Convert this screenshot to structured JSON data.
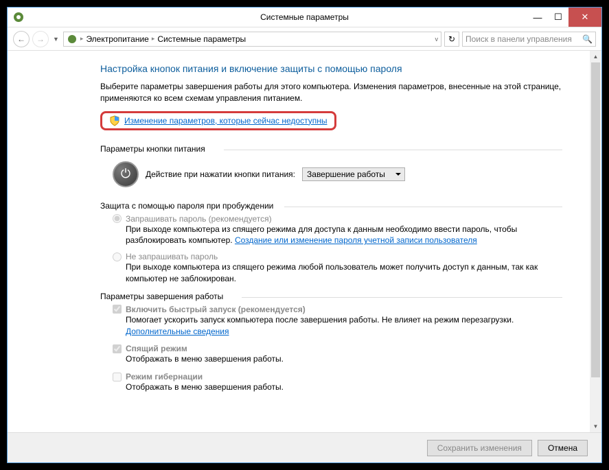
{
  "titlebar": {
    "title": "Системные параметры"
  },
  "breadcrumb": {
    "item1": "Электропитание",
    "item2": "Системные параметры"
  },
  "search": {
    "placeholder": "Поиск в панели управления"
  },
  "heading": "Настройка кнопок питания и включение защиты с помощью пароля",
  "intro": "Выберите параметры завершения работы для этого компьютера. Изменения параметров, внесенные на этой странице, применяются ко всем схемам управления питанием.",
  "change_link": "Изменение параметров, которые сейчас недоступны",
  "sections": {
    "buttons": {
      "title": "Параметры кнопки питания",
      "action_label": "Действие при нажатии кнопки питания:",
      "action_value": "Завершение работы"
    },
    "password": {
      "title": "Защита с помощью пароля при пробуждении",
      "opt1_label": "Запрашивать пароль (рекомендуется)",
      "opt1_desc_a": "При выходе компьютера из спящего режима для доступа к данным необходимо ввести пароль, чтобы разблокировать компьютер. ",
      "opt1_link": "Создание или изменение пароля учетной записи пользователя",
      "opt2_label": "Не запрашивать пароль",
      "opt2_desc": "При выходе компьютера из спящего режима любой пользователь может получить доступ к данным, так как компьютер не заблокирован."
    },
    "shutdown": {
      "title": "Параметры завершения работы",
      "fast_label": "Включить быстрый запуск (рекомендуется)",
      "fast_desc_a": "Помогает ускорить запуск компьютера после завершения работы. Не влияет на режим перезагрузки. ",
      "fast_link": "Дополнительные сведения",
      "sleep_label": "Спящий режим",
      "sleep_desc": "Отображать в меню завершения работы.",
      "hiber_label": "Режим гибернации",
      "hiber_desc": "Отображать в меню завершения работы."
    }
  },
  "footer": {
    "save": "Сохранить изменения",
    "cancel": "Отмена"
  }
}
